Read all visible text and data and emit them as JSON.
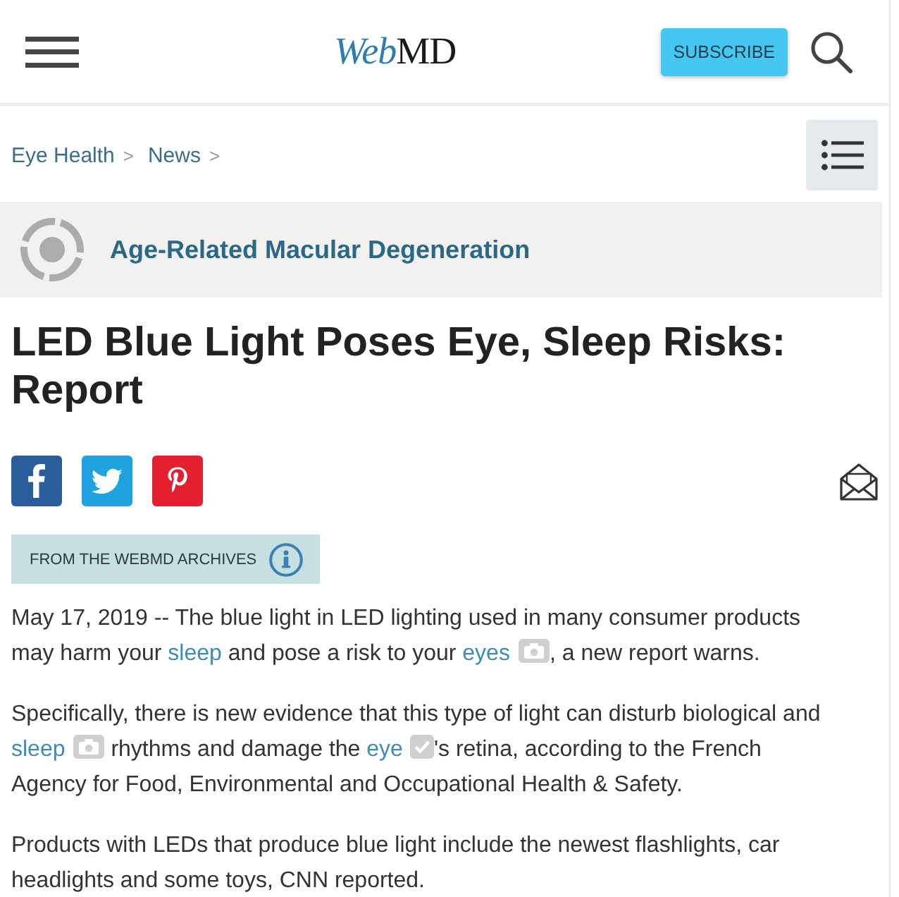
{
  "header": {
    "logo": [
      "Web",
      "MD"
    ],
    "subscribe_button": "SUBSCRIBE"
  },
  "breadcrumb": [
    {
      "label": "Eye Health",
      "separator": ">"
    },
    {
      "label": "News",
      "separator": ">"
    }
  ],
  "topic": {
    "label": "Age-Related Macular Degeneration"
  },
  "article": {
    "title": "LED Blue Light Poses Eye, Sleep Risks: Report",
    "share_buttons": [
      {
        "kind": "facebook"
      },
      {
        "kind": "twitter"
      },
      {
        "kind": "pinterest"
      }
    ],
    "archive_badge": "FROM THE WEBMD ARCHIVES",
    "paragraphs": [
      [
        {
          "kind": "text",
          "text": "May 17, 2019 -- The blue light in LED lighting used in many consumer products may harm your "
        },
        {
          "kind": "link",
          "text": "sleep"
        },
        {
          "kind": "text",
          "text": " and pose a risk to your "
        },
        {
          "kind": "link",
          "text": "eyes"
        },
        {
          "kind": "camera"
        },
        {
          "kind": "text",
          "text": ", a new report warns."
        }
      ],
      [
        {
          "kind": "text",
          "text": "Specifically, there is new evidence that this type of light can disturb biological and "
        },
        {
          "kind": "link",
          "text": "sleep"
        },
        {
          "kind": "camera"
        },
        {
          "kind": "text",
          "text": " rhythms and damage the "
        },
        {
          "kind": "link",
          "text": "eye"
        },
        {
          "kind": "check"
        },
        {
          "kind": "text",
          "text": "'s retina, according to the French Agency for Food, Environmental and Occupational Health & Safety."
        }
      ],
      [
        {
          "kind": "text",
          "text": "Products with LEDs that produce blue light include the newest flashlights, car headlights and some toys, CNN reported."
        }
      ]
    ]
  }
}
